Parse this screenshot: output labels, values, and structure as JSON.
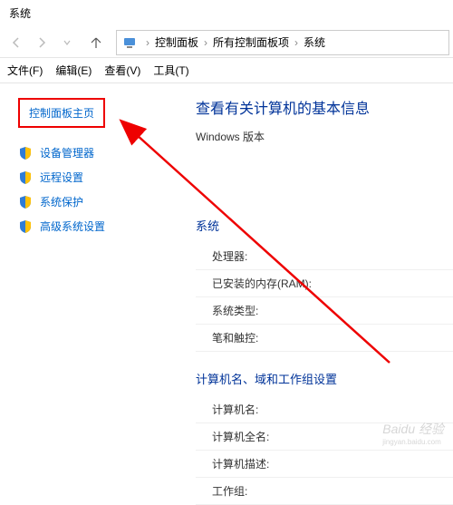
{
  "window": {
    "title": "系统"
  },
  "breadcrumb": {
    "items": [
      "控制面板",
      "所有控制面板项",
      "系统"
    ]
  },
  "menubar": {
    "items": [
      "文件(F)",
      "编辑(E)",
      "查看(V)",
      "工具(T)"
    ]
  },
  "sidebar": {
    "home": "控制面板主页",
    "links": [
      {
        "label": "设备管理器"
      },
      {
        "label": "远程设置"
      },
      {
        "label": "系统保护"
      },
      {
        "label": "高级系统设置"
      }
    ]
  },
  "main": {
    "heading": "查看有关计算机的基本信息",
    "win_edition_label": "Windows 版本",
    "system_label": "系统",
    "system_fields": [
      "处理器:",
      "已安装的内存(RAM):",
      "系统类型:",
      "笔和触控:"
    ],
    "name_label": "计算机名、域和工作组设置",
    "name_fields": [
      "计算机名:",
      "计算机全名:",
      "计算机描述:",
      "工作组:"
    ]
  },
  "watermark": {
    "main": "Baidu 经验",
    "sub": "jingyan.baidu.com"
  }
}
